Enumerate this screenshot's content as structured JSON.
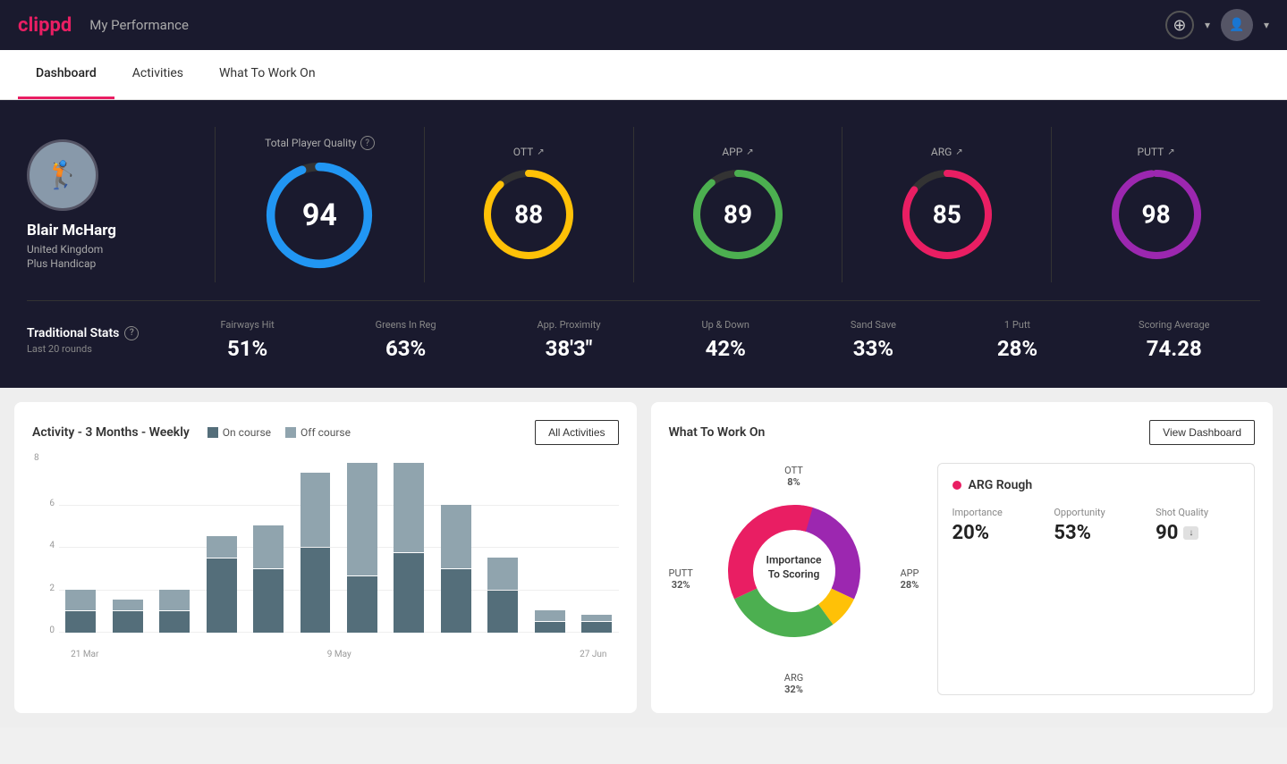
{
  "app": {
    "logo": "clippd",
    "header_title": "My Performance"
  },
  "nav": {
    "items": [
      {
        "id": "dashboard",
        "label": "Dashboard",
        "active": true
      },
      {
        "id": "activities",
        "label": "Activities",
        "active": false
      },
      {
        "id": "what-to-work-on",
        "label": "What To Work On",
        "active": false
      }
    ]
  },
  "profile": {
    "name": "Blair McHarg",
    "country": "United Kingdom",
    "handicap": "Plus Handicap",
    "avatar_emoji": "🏌️"
  },
  "scores": {
    "total": {
      "label": "Total Player Quality",
      "value": 94,
      "color": "#2196F3",
      "percent": 94
    },
    "categories": [
      {
        "id": "ott",
        "label": "OTT",
        "value": 88,
        "color": "#FFC107",
        "percent": 88
      },
      {
        "id": "app",
        "label": "APP",
        "value": 89,
        "color": "#4CAF50",
        "percent": 89
      },
      {
        "id": "arg",
        "label": "ARG",
        "value": 85,
        "color": "#e91e63",
        "percent": 85
      },
      {
        "id": "putt",
        "label": "PUTT",
        "value": 98,
        "color": "#9C27B0",
        "percent": 98
      }
    ]
  },
  "traditional_stats": {
    "title": "Traditional Stats",
    "subtitle": "Last 20 rounds",
    "items": [
      {
        "label": "Fairways Hit",
        "value": "51%"
      },
      {
        "label": "Greens In Reg",
        "value": "63%"
      },
      {
        "label": "App. Proximity",
        "value": "38'3\""
      },
      {
        "label": "Up & Down",
        "value": "42%"
      },
      {
        "label": "Sand Save",
        "value": "33%"
      },
      {
        "label": "1 Putt",
        "value": "28%"
      },
      {
        "label": "Scoring Average",
        "value": "74.28"
      }
    ]
  },
  "activity_chart": {
    "title": "Activity - 3 Months - Weekly",
    "legend": [
      {
        "label": "On course",
        "color": "#546e7a"
      },
      {
        "label": "Off course",
        "color": "#90a4ae"
      }
    ],
    "all_activities_label": "All Activities",
    "x_labels": [
      "21 Mar",
      "9 May",
      "27 Jun"
    ],
    "y_labels": [
      "0",
      "2",
      "4",
      "6",
      "8"
    ],
    "bars": [
      {
        "on": 1,
        "off": 1
      },
      {
        "on": 1,
        "off": 0.5
      },
      {
        "on": 1,
        "off": 1
      },
      {
        "on": 3.5,
        "off": 1
      },
      {
        "on": 3,
        "off": 2
      },
      {
        "on": 4,
        "off": 3.5
      },
      {
        "on": 3,
        "off": 6
      },
      {
        "on": 4,
        "off": 4.5
      },
      {
        "on": 3,
        "off": 3
      },
      {
        "on": 2,
        "off": 1.5
      },
      {
        "on": 0.5,
        "off": 0.5
      },
      {
        "on": 0.5,
        "off": 0.3
      }
    ]
  },
  "what_to_work_on": {
    "title": "What To Work On",
    "view_dashboard_label": "View Dashboard",
    "donut": {
      "center_text": "Importance\nTo Scoring",
      "segments": [
        {
          "label": "OTT",
          "value": "8%",
          "color": "#FFC107",
          "position": "top"
        },
        {
          "label": "APP",
          "value": "28%",
          "color": "#4CAF50",
          "position": "right"
        },
        {
          "label": "ARG",
          "value": "32%",
          "color": "#e91e63",
          "position": "bottom"
        },
        {
          "label": "PUTT",
          "value": "32%",
          "color": "#9C27B0",
          "position": "left"
        }
      ]
    },
    "info_card": {
      "title": "ARG Rough",
      "dot_color": "#e91e63",
      "metrics": [
        {
          "label": "Importance",
          "value": "20%"
        },
        {
          "label": "Opportunity",
          "value": "53%"
        },
        {
          "label": "Shot Quality",
          "value": "90",
          "badge": "↓"
        }
      ]
    }
  }
}
